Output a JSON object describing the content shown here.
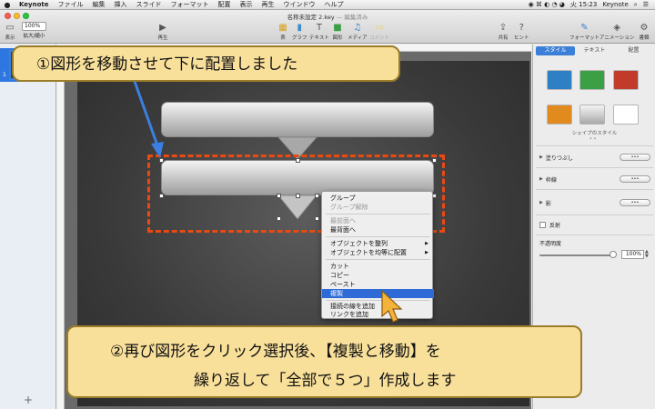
{
  "menubar": {
    "apple": "",
    "items": [
      "Keynote",
      "ファイル",
      "編集",
      "挿入",
      "スライド",
      "フォーマット",
      "配置",
      "表示",
      "再生",
      "ウインドウ",
      "ヘルプ"
    ],
    "clock": "火 15:23",
    "user": "Keynote"
  },
  "window": {
    "title": "名称未設定 2.key",
    "title_suffix": "— 編集済み"
  },
  "toolbar": {
    "view_label": "表示",
    "zoom_value": "100%",
    "zoom_label": "拡大/縮小",
    "play_label": "再生",
    "table_label": "表",
    "chart_label": "グラフ",
    "text_label": "テキスト",
    "shape_label": "図形",
    "media_label": "メディア",
    "comment_label": "コメント",
    "share_label": "共有",
    "tips_label": "ヒント",
    "format_label": "フォーマット",
    "animate_label": "アニメーション",
    "document_label": "書類"
  },
  "navigator": {
    "slide_number": "1",
    "add_label": "+"
  },
  "inspector": {
    "tabs": [
      "スタイル",
      "テキスト",
      "配置"
    ],
    "swatch_colors": [
      "#2e7fc4",
      "#3aa043",
      "#c23b2a",
      "#e18b1f",
      "#c8c8c8",
      "#ffffff"
    ],
    "shape_style_caption": "シェイプのスタイル",
    "page_dots": "• •",
    "fill_label": "塗りつぶし",
    "border_label": "枠線",
    "shadow_label": "影",
    "reflection_label": "反射",
    "opacity_label": "不透明度",
    "opacity_value": "100%",
    "more_label": "•••"
  },
  "context_menu": {
    "items": [
      {
        "label": "グループ",
        "disabled": false
      },
      {
        "label": "グループ解除",
        "disabled": true
      },
      {
        "label": "最前面へ",
        "disabled": true
      },
      {
        "label": "最背面へ",
        "disabled": false
      },
      {
        "label": "オブジェクトを整列",
        "disabled": false,
        "submenu": true
      },
      {
        "label": "オブジェクトを均等に配置",
        "disabled": false,
        "submenu": true
      },
      {
        "label": "カット",
        "disabled": false
      },
      {
        "label": "コピー",
        "disabled": false
      },
      {
        "label": "ペースト",
        "disabled": false
      },
      {
        "label": "複製",
        "disabled": false,
        "highlighted": true
      },
      {
        "label": "接続の線を追加",
        "disabled": false
      },
      {
        "label": "リンクを追加",
        "disabled": false
      }
    ],
    "submenu_arrow": "▶"
  },
  "callouts": {
    "step1": "①図形を移動させて下に配置しました",
    "step2_line1": "②再び図形をクリック選択後、【複製と移動】を",
    "step2_line2": "繰り返して「全部で５つ」作成します"
  },
  "colors": {
    "accent_blue": "#3b7fd8",
    "annotation_orange": "#ea4a12",
    "callout_fill": "#f9e09a",
    "arrow_blue": "#3b7fe0"
  }
}
